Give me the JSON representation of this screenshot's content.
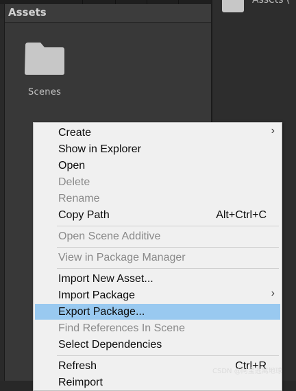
{
  "assets_panel": {
    "title": "Assets"
  },
  "folder": {
    "name": "Scenes",
    "icon": "folder-icon"
  },
  "right_panel": {
    "title_fragment": "Assets ("
  },
  "context_menu": {
    "items": [
      {
        "label": "Create",
        "enabled": true,
        "submenu": true
      },
      {
        "label": "Show in Explorer",
        "enabled": true
      },
      {
        "label": "Open",
        "enabled": true
      },
      {
        "label": "Delete",
        "enabled": false
      },
      {
        "label": "Rename",
        "enabled": false
      },
      {
        "label": "Copy Path",
        "enabled": true,
        "shortcut": "Alt+Ctrl+C"
      },
      {
        "label": "Open Scene Additive",
        "enabled": false
      },
      {
        "label": "View in Package Manager",
        "enabled": false
      },
      {
        "label": "Import New Asset...",
        "enabled": true
      },
      {
        "label": "Import Package",
        "enabled": true,
        "submenu": true
      },
      {
        "label": "Export Package...",
        "enabled": true,
        "highlighted": true
      },
      {
        "label": "Find References In Scene",
        "enabled": false
      },
      {
        "label": "Select Dependencies",
        "enabled": true
      },
      {
        "label": "Refresh",
        "enabled": true,
        "shortcut": "Ctrl+R"
      },
      {
        "label": "Reimport",
        "enabled": true
      }
    ],
    "submenu_arrow": "›",
    "highlight_color": "#99c9f0"
  },
  "watermark": "CSDN @阿宝逃离地球"
}
